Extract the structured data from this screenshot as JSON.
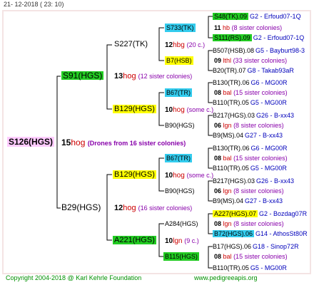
{
  "header": {
    "date": "21- 12-2018 ( 23: 10)"
  },
  "footer": {
    "copyright": "Copyright 2004-2018 @ Karl Kehrle Foundation",
    "site": "www.pedigreeapis.org"
  },
  "root": {
    "name": "S126(HGS)"
  },
  "gen": {
    "g0": {
      "num": "15",
      "hog": "hog",
      "sis": "(Drones from 16 sister colonies)"
    },
    "g1": {
      "num": "13",
      "hog": "hog",
      "sis": "(12 sister colonies)"
    },
    "g2": {
      "num": "12",
      "hog": "hog",
      "sis": "(16 sister colonies)"
    },
    "g3": {
      "num": "12",
      "hog": "hbg",
      "sis": "(20 c.)"
    },
    "g4": {
      "num": "10",
      "hog": "hog",
      "sis": "(some c.)"
    },
    "g5": {
      "num": "10",
      "hog": "hog",
      "sis": "(some c.)"
    },
    "g6": {
      "num": "10",
      "hog": "lgn",
      "sis": "(9 c.)"
    },
    "g7": {
      "num": "11",
      "hog": "hb",
      "sis": "(8 sister colonies)"
    },
    "g8": {
      "num": "09",
      "hog": "lthl",
      "sis": "(33 sister colonies)"
    },
    "g9": {
      "num": "08",
      "hog": "bal",
      "sis": "(15 sister colonies)"
    },
    "g10": {
      "num": "06",
      "hog": "lgn",
      "sis": "(8 sister colonies)"
    },
    "g11": {
      "num": "08",
      "hog": "bal",
      "sis": "(15 sister colonies)"
    },
    "g12": {
      "num": "06",
      "hog": "lgn",
      "sis": "(8 sister colonies)"
    },
    "g13": {
      "num": "08",
      "hog": "lgn",
      "sis": "(8 sister colonies)"
    },
    "g14": {
      "num": "08",
      "hog": "bal",
      "sis": "(15 sister colonies)"
    }
  },
  "l1": {
    "s91": "S91(HGS)",
    "b29": "B29(HGS)"
  },
  "l2": {
    "s227": "S227(TK)",
    "b129a": "B129(HGS)",
    "b129b": "B129(HGS)",
    "a221": "A221(HGS)"
  },
  "l3": {
    "s733": "S733(TK)",
    "b7": "B7(HSB)",
    "b67a": "B67(TR)",
    "b90a": "B90(HGS)",
    "b67b": "B67(TR)",
    "b90b": "B90(HGS)",
    "a284": "A284(HGS)",
    "b115": "B115(HGS)"
  },
  "l4": [
    {
      "name": "S48(TK).09",
      "right": "G2 - Erfoud07-1Q"
    },
    {
      "name": "S111(RS).09",
      "right": "G2 - Erfoud07-1Q"
    },
    {
      "name": "B507(HSB).08",
      "right": "G5 - Bayburt98-3"
    },
    {
      "name": "B20(TR).07",
      "right": "G8 - Takab93aR"
    },
    {
      "name": "B130(TR).06",
      "right": "G6 - MG00R"
    },
    {
      "name": "B110(TR).05",
      "right": "G5 - MG00R"
    },
    {
      "name": "B217(HGS).03",
      "right": "G26 - B-xx43"
    },
    {
      "name": "B9(MS).04",
      "right": "G27 - B-xx43"
    },
    {
      "name": "B130(TR).06",
      "right": "G6 - MG00R"
    },
    {
      "name": "B110(TR).05",
      "right": "G5 - MG00R"
    },
    {
      "name": "B217(HGS).03",
      "right": "G26 - B-xx43"
    },
    {
      "name": "B9(MS).04",
      "right": "G27 - B-xx43"
    },
    {
      "name": "A227(HGS).07",
      "right": "G2 - Bozdag07R"
    },
    {
      "name": "B72(HGS).06",
      "right": "G14 - AthosSt80R"
    },
    {
      "name": "B17(HGS).06",
      "right": "G18 - Sinop72R"
    },
    {
      "name": "B110(TR).05",
      "right": "G5 - MG00R"
    }
  ],
  "colors": {
    "green": "#22cc22",
    "yellow": "#ffff00",
    "cyan": "#33ccee",
    "pink": "#ffccff",
    "hog": "#cc0000",
    "sister": "#8800aa",
    "footer": "#009000"
  }
}
